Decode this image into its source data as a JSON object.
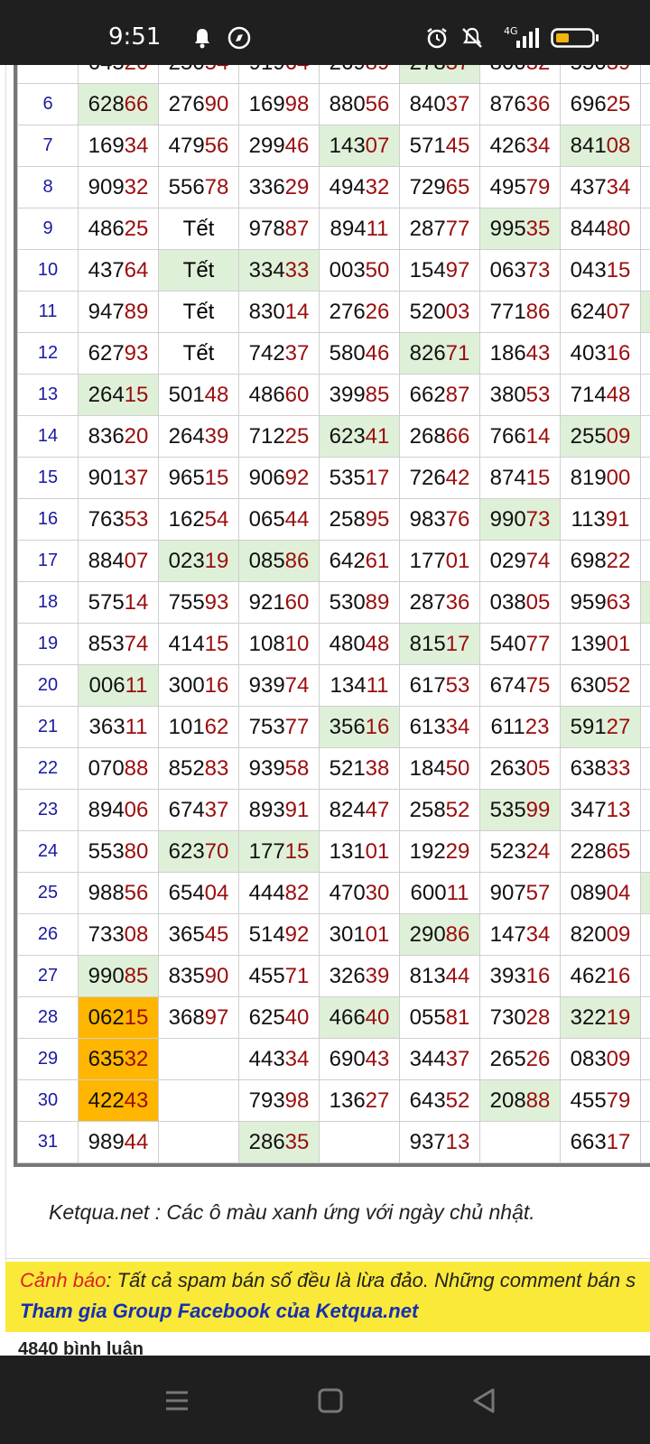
{
  "status_bar": {
    "time": "9:51",
    "icons": [
      "bell-icon",
      "compass-icon",
      "alarm-icon",
      "mute-icon",
      "signal-4g-icon",
      "battery-icon"
    ],
    "network_label": "4G"
  },
  "table": {
    "partial_row": [
      "64520",
      "25054",
      "91964",
      "26989",
      "27837",
      "80032",
      "55039"
    ],
    "rows": [
      {
        "day": "6",
        "cells": [
          {
            "v": "62866",
            "s": "sun"
          },
          {
            "v": "27690"
          },
          {
            "v": "16998"
          },
          {
            "v": "88056"
          },
          {
            "v": "84037"
          },
          {
            "v": "87636"
          },
          {
            "v": "69625"
          }
        ]
      },
      {
        "day": "7",
        "cells": [
          {
            "v": "16934"
          },
          {
            "v": "47956"
          },
          {
            "v": "29946"
          },
          {
            "v": "14307",
            "s": "sun"
          },
          {
            "v": "57145"
          },
          {
            "v": "42634"
          },
          {
            "v": "84108",
            "s": "sun"
          }
        ]
      },
      {
        "day": "8",
        "cells": [
          {
            "v": "90932"
          },
          {
            "v": "55678"
          },
          {
            "v": "33629"
          },
          {
            "v": "49432"
          },
          {
            "v": "72965"
          },
          {
            "v": "49579"
          },
          {
            "v": "43734"
          }
        ]
      },
      {
        "day": "9",
        "cells": [
          {
            "v": "48625"
          },
          {
            "v": "Tết"
          },
          {
            "v": "97887"
          },
          {
            "v": "89411"
          },
          {
            "v": "28777"
          },
          {
            "v": "99535",
            "s": "sun"
          },
          {
            "v": "84480"
          }
        ]
      },
      {
        "day": "10",
        "cells": [
          {
            "v": "43764"
          },
          {
            "v": "Tết",
            "s": "sun"
          },
          {
            "v": "33433",
            "s": "sun"
          },
          {
            "v": "00350"
          },
          {
            "v": "15497"
          },
          {
            "v": "06373"
          },
          {
            "v": "04315"
          }
        ]
      },
      {
        "day": "11",
        "cells": [
          {
            "v": "94789"
          },
          {
            "v": "Tết"
          },
          {
            "v": "83014"
          },
          {
            "v": "27626"
          },
          {
            "v": "52003"
          },
          {
            "v": "77186"
          },
          {
            "v": "62407"
          }
        ]
      },
      {
        "day": "12",
        "cells": [
          {
            "v": "62793"
          },
          {
            "v": "Tết"
          },
          {
            "v": "74237"
          },
          {
            "v": "58046"
          },
          {
            "v": "82671",
            "s": "sun"
          },
          {
            "v": "18643"
          },
          {
            "v": "40316"
          }
        ]
      },
      {
        "day": "13",
        "cells": [
          {
            "v": "26415",
            "s": "sun"
          },
          {
            "v": "50148"
          },
          {
            "v": "48660"
          },
          {
            "v": "39985"
          },
          {
            "v": "66287"
          },
          {
            "v": "38053"
          },
          {
            "v": "71448"
          }
        ]
      },
      {
        "day": "14",
        "cells": [
          {
            "v": "83620"
          },
          {
            "v": "26439"
          },
          {
            "v": "71225"
          },
          {
            "v": "62341",
            "s": "sun"
          },
          {
            "v": "26866"
          },
          {
            "v": "76614"
          },
          {
            "v": "25509",
            "s": "sun"
          }
        ]
      },
      {
        "day": "15",
        "cells": [
          {
            "v": "90137"
          },
          {
            "v": "96515"
          },
          {
            "v": "90692"
          },
          {
            "v": "53517"
          },
          {
            "v": "72642"
          },
          {
            "v": "87415"
          },
          {
            "v": "81900"
          }
        ]
      },
      {
        "day": "16",
        "cells": [
          {
            "v": "76353"
          },
          {
            "v": "16254"
          },
          {
            "v": "06544"
          },
          {
            "v": "25895"
          },
          {
            "v": "98376"
          },
          {
            "v": "99073",
            "s": "sun"
          },
          {
            "v": "11391"
          }
        ]
      },
      {
        "day": "17",
        "cells": [
          {
            "v": "88407"
          },
          {
            "v": "02319",
            "s": "sun"
          },
          {
            "v": "08586",
            "s": "sun"
          },
          {
            "v": "64261"
          },
          {
            "v": "17701"
          },
          {
            "v": "02974"
          },
          {
            "v": "69822"
          }
        ]
      },
      {
        "day": "18",
        "cells": [
          {
            "v": "57514"
          },
          {
            "v": "75593"
          },
          {
            "v": "92160"
          },
          {
            "v": "53089"
          },
          {
            "v": "28736"
          },
          {
            "v": "03805"
          },
          {
            "v": "95963"
          }
        ]
      },
      {
        "day": "19",
        "cells": [
          {
            "v": "85374"
          },
          {
            "v": "41415"
          },
          {
            "v": "10810"
          },
          {
            "v": "48048"
          },
          {
            "v": "81517",
            "s": "sun"
          },
          {
            "v": "54077"
          },
          {
            "v": "13901"
          }
        ]
      },
      {
        "day": "20",
        "cells": [
          {
            "v": "00611",
            "s": "sun"
          },
          {
            "v": "30016"
          },
          {
            "v": "93974"
          },
          {
            "v": "13411"
          },
          {
            "v": "61753"
          },
          {
            "v": "67475"
          },
          {
            "v": "63052"
          }
        ]
      },
      {
        "day": "21",
        "cells": [
          {
            "v": "36311"
          },
          {
            "v": "10162"
          },
          {
            "v": "75377"
          },
          {
            "v": "35616",
            "s": "sun"
          },
          {
            "v": "61334"
          },
          {
            "v": "61123"
          },
          {
            "v": "59127",
            "s": "sun"
          }
        ]
      },
      {
        "day": "22",
        "cells": [
          {
            "v": "07088"
          },
          {
            "v": "85283"
          },
          {
            "v": "93958"
          },
          {
            "v": "52138"
          },
          {
            "v": "18450"
          },
          {
            "v": "26305"
          },
          {
            "v": "63833"
          }
        ]
      },
      {
        "day": "23",
        "cells": [
          {
            "v": "89406"
          },
          {
            "v": "67437"
          },
          {
            "v": "89391"
          },
          {
            "v": "82447"
          },
          {
            "v": "25852"
          },
          {
            "v": "53599",
            "s": "sun"
          },
          {
            "v": "34713"
          }
        ]
      },
      {
        "day": "24",
        "cells": [
          {
            "v": "55380"
          },
          {
            "v": "62370",
            "s": "sun"
          },
          {
            "v": "17715",
            "s": "sun"
          },
          {
            "v": "13101"
          },
          {
            "v": "19229"
          },
          {
            "v": "52324"
          },
          {
            "v": "22865"
          }
        ]
      },
      {
        "day": "25",
        "cells": [
          {
            "v": "98856"
          },
          {
            "v": "65404"
          },
          {
            "v": "44482"
          },
          {
            "v": "47030"
          },
          {
            "v": "60011"
          },
          {
            "v": "90757"
          },
          {
            "v": "08904"
          }
        ]
      },
      {
        "day": "26",
        "cells": [
          {
            "v": "73308"
          },
          {
            "v": "36545"
          },
          {
            "v": "51492"
          },
          {
            "v": "30101"
          },
          {
            "v": "29086",
            "s": "sun"
          },
          {
            "v": "14734"
          },
          {
            "v": "82009"
          }
        ]
      },
      {
        "day": "27",
        "cells": [
          {
            "v": "99085",
            "s": "sun"
          },
          {
            "v": "83590"
          },
          {
            "v": "45571"
          },
          {
            "v": "32639"
          },
          {
            "v": "81344"
          },
          {
            "v": "39316"
          },
          {
            "v": "46216"
          }
        ]
      },
      {
        "day": "28",
        "cells": [
          {
            "v": "06215",
            "s": "hl"
          },
          {
            "v": "36897"
          },
          {
            "v": "62540"
          },
          {
            "v": "46640",
            "s": "sun"
          },
          {
            "v": "05581"
          },
          {
            "v": "73028"
          },
          {
            "v": "32219",
            "s": "sun"
          }
        ]
      },
      {
        "day": "29",
        "cells": [
          {
            "v": "63532",
            "s": "hl"
          },
          {
            "v": ""
          },
          {
            "v": "44334"
          },
          {
            "v": "69043"
          },
          {
            "v": "34437"
          },
          {
            "v": "26526"
          },
          {
            "v": "08309"
          }
        ]
      },
      {
        "day": "30",
        "cells": [
          {
            "v": "42243",
            "s": "hl"
          },
          {
            "v": ""
          },
          {
            "v": "79398"
          },
          {
            "v": "13627"
          },
          {
            "v": "64352"
          },
          {
            "v": "20888",
            "s": "sun"
          },
          {
            "v": "45579"
          }
        ]
      },
      {
        "day": "31",
        "cells": [
          {
            "v": "98944"
          },
          {
            "v": ""
          },
          {
            "v": "28635",
            "s": "sun"
          },
          {
            "v": ""
          },
          {
            "v": "93713"
          },
          {
            "v": ""
          },
          {
            "v": "66317"
          }
        ]
      }
    ],
    "edge_green_rows": [
      "11",
      "18",
      "25"
    ]
  },
  "note": "Ketqua.net : Các ô màu xanh ứng với ngày chủ nhật.",
  "warning": {
    "label": "Cảnh báo",
    "text": ": Tất cả spam bán số đều là lừa đảo. Những comment bán s",
    "link": "Tham gia Group Facebook của Ketqua.net"
  },
  "comments_count_label": "4840 bình luận",
  "nav_bar": {
    "buttons": [
      "menu-icon",
      "home-icon",
      "back-icon"
    ]
  },
  "colors": {
    "sunday_cell": "#dff0d8",
    "highlight_cell": "#ffb600",
    "digits_red": "#9b0d0d",
    "day_blue": "#1a1aa0",
    "warning_bg": "#fbe93a",
    "link_blue": "#1430b4"
  }
}
